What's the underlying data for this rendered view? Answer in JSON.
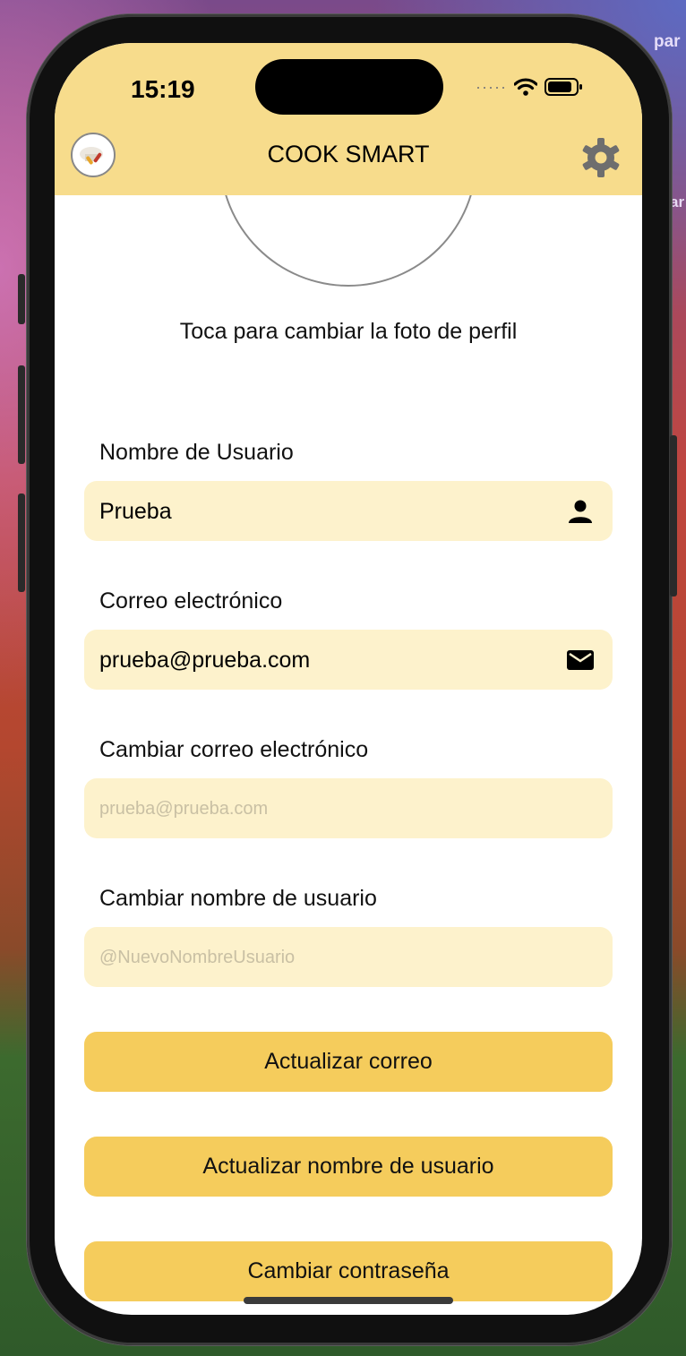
{
  "desktop": {
    "edge_text_1": "par",
    "edge_text_2": "ar"
  },
  "status_bar": {
    "time": "15:19",
    "dots": "·····"
  },
  "header": {
    "title": "COOK SMART"
  },
  "profile": {
    "caption": "Toca para cambiar la foto de perfil"
  },
  "fields": {
    "username": {
      "label": "Nombre de Usuario",
      "value": "Prueba"
    },
    "email": {
      "label": "Correo electrónico",
      "value": "prueba@prueba.com"
    },
    "new_email": {
      "label": "Cambiar correo electrónico",
      "placeholder": "prueba@prueba.com"
    },
    "new_username": {
      "label": "Cambiar nombre de usuario",
      "placeholder": "@NuevoNombreUsuario"
    }
  },
  "buttons": {
    "update_email": "Actualizar correo",
    "update_username": "Actualizar nombre de usuario",
    "change_password": "Cambiar contraseña"
  },
  "colors": {
    "header_bg": "#f7dc8c",
    "field_bg": "#fdf2cc",
    "button_bg": "#f5cc5c"
  },
  "icons": [
    "settings-gear-icon",
    "user-icon",
    "mail-icon",
    "wifi-icon",
    "battery-icon"
  ]
}
